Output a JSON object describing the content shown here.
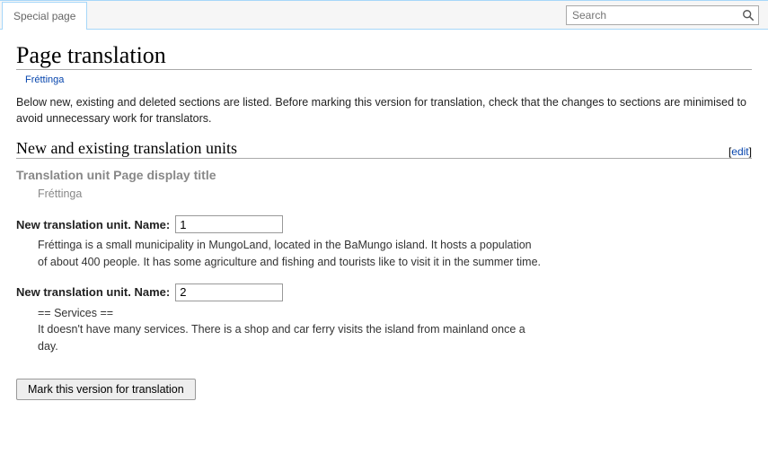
{
  "tabbar": {
    "special_tab": "Special page"
  },
  "search": {
    "placeholder": "Search"
  },
  "page": {
    "title": "Page translation",
    "back_link": "Fréttinga",
    "intro": "Below new, existing and deleted sections are listed. Before marking this version for translation, check that the changes to sections are minimised to avoid unnecessary work for translators."
  },
  "section": {
    "heading": "New and existing translation units",
    "edit_label": "edit"
  },
  "display_unit": {
    "heading": "Translation unit Page display title",
    "body": "Fréttinga"
  },
  "new_unit_label": "New translation unit. Name:",
  "units": [
    {
      "name_value": "1",
      "body": "Fréttinga is a small municipality in MungoLand, located in the BaMungo island. It hosts a population of about 400 people. It has some agriculture and fishing and tourists like to visit it in the summer time."
    },
    {
      "name_value": "2",
      "body": "== Services ==\nIt doesn't have many services. There is a shop and car ferry visits the island from mainland once a day."
    }
  ],
  "mark_button": "Mark this version for translation"
}
